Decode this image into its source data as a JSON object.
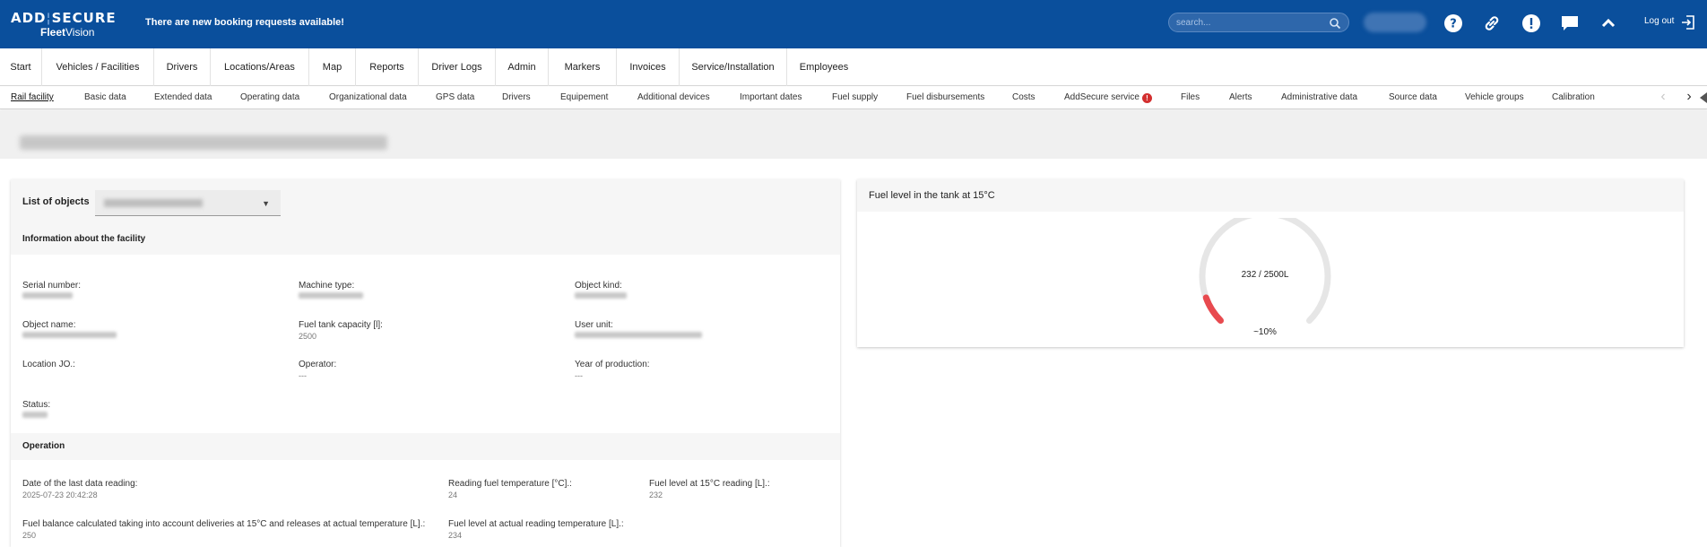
{
  "header": {
    "logo_brand_left": "ADD",
    "logo_brand_right": "SECURE",
    "logo_sub_a": "Fleet",
    "logo_sub_b": "Vision",
    "notice": "There are new booking requests available!",
    "search_placeholder": "search...",
    "logout": "Log out",
    "icons": [
      "help-icon",
      "link-icon",
      "alert-icon",
      "chat-icon",
      "collapse-up-icon",
      "logout-icon"
    ]
  },
  "main_nav": [
    "Start",
    "Vehicles / Facilities",
    "Drivers",
    "Locations/Areas",
    "Map",
    "Reports",
    "Driver Logs",
    "Admin",
    "Markers",
    "Invoices",
    "Service/Installation",
    "Employees"
  ],
  "sub_tabs": [
    "Rail facility",
    "Basic data",
    "Extended data",
    "Operating data",
    "Organizational data",
    "GPS data",
    "Drivers",
    "Equipement",
    "Additional devices",
    "Important dates",
    "Fuel supply",
    "Fuel disbursements",
    "Costs",
    "AddSecure service",
    "Files",
    "Alerts",
    "Administrative data",
    "Source data",
    "Vehicle groups",
    "Calibration"
  ],
  "sub_tab_warning": "!",
  "left_panel": {
    "list_of_objects": "List of objects",
    "info_title": "Information about the facility",
    "fields": {
      "serial_number": "Serial number:",
      "machine_type": "Machine type:",
      "object_kind": "Object kind:",
      "object_name": "Object name:",
      "fuel_tank_capacity": "Fuel tank capacity [l]:",
      "fuel_tank_capacity_val": "2500",
      "user_unit": "User unit:",
      "location_jo": "Location JO.:",
      "operator": "Operator:",
      "operator_val": "---",
      "year_of_production": "Year of production:",
      "year_of_production_val": "---",
      "status": "Status:"
    },
    "operation_title": "Operation",
    "operation": {
      "last_reading": "Date of the last data reading:",
      "last_reading_val": "2025-07-23 20:42:28",
      "reading_temp": "Reading fuel temperature [°C].:",
      "reading_temp_val": "24",
      "fuel_level_15": "Fuel level at 15°C reading [L].:",
      "fuel_level_15_val": "232",
      "fuel_balance": "Fuel balance calculated taking into account deliveries at 15°C and releases at actual temperature [L].:",
      "fuel_balance_val": "250",
      "fuel_level_actual": "Fuel level at actual reading temperature [L].:",
      "fuel_level_actual_val": "234"
    }
  },
  "right_panel": {
    "title": "Fuel level in the tank at 15°C",
    "gauge_text": "232 / 2500L",
    "gauge_pct_text": "~10%",
    "gauge_value": 232,
    "gauge_max": 2500,
    "colors": {
      "track": "#e6e6e6",
      "fill": "#e84a4f"
    }
  }
}
